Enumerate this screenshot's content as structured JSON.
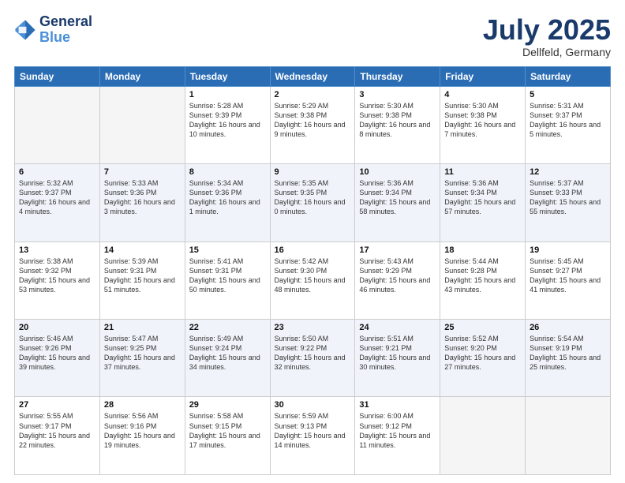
{
  "header": {
    "logo_line1": "General",
    "logo_line2": "Blue",
    "month": "July 2025",
    "location": "Dellfeld, Germany"
  },
  "days_of_week": [
    "Sunday",
    "Monday",
    "Tuesday",
    "Wednesday",
    "Thursday",
    "Friday",
    "Saturday"
  ],
  "weeks": [
    [
      {
        "day": "",
        "sunrise": "",
        "sunset": "",
        "daylight": ""
      },
      {
        "day": "",
        "sunrise": "",
        "sunset": "",
        "daylight": ""
      },
      {
        "day": "1",
        "sunrise": "Sunrise: 5:28 AM",
        "sunset": "Sunset: 9:39 PM",
        "daylight": "Daylight: 16 hours and 10 minutes."
      },
      {
        "day": "2",
        "sunrise": "Sunrise: 5:29 AM",
        "sunset": "Sunset: 9:38 PM",
        "daylight": "Daylight: 16 hours and 9 minutes."
      },
      {
        "day": "3",
        "sunrise": "Sunrise: 5:30 AM",
        "sunset": "Sunset: 9:38 PM",
        "daylight": "Daylight: 16 hours and 8 minutes."
      },
      {
        "day": "4",
        "sunrise": "Sunrise: 5:30 AM",
        "sunset": "Sunset: 9:38 PM",
        "daylight": "Daylight: 16 hours and 7 minutes."
      },
      {
        "day": "5",
        "sunrise": "Sunrise: 5:31 AM",
        "sunset": "Sunset: 9:37 PM",
        "daylight": "Daylight: 16 hours and 5 minutes."
      }
    ],
    [
      {
        "day": "6",
        "sunrise": "Sunrise: 5:32 AM",
        "sunset": "Sunset: 9:37 PM",
        "daylight": "Daylight: 16 hours and 4 minutes."
      },
      {
        "day": "7",
        "sunrise": "Sunrise: 5:33 AM",
        "sunset": "Sunset: 9:36 PM",
        "daylight": "Daylight: 16 hours and 3 minutes."
      },
      {
        "day": "8",
        "sunrise": "Sunrise: 5:34 AM",
        "sunset": "Sunset: 9:36 PM",
        "daylight": "Daylight: 16 hours and 1 minute."
      },
      {
        "day": "9",
        "sunrise": "Sunrise: 5:35 AM",
        "sunset": "Sunset: 9:35 PM",
        "daylight": "Daylight: 16 hours and 0 minutes."
      },
      {
        "day": "10",
        "sunrise": "Sunrise: 5:36 AM",
        "sunset": "Sunset: 9:34 PM",
        "daylight": "Daylight: 15 hours and 58 minutes."
      },
      {
        "day": "11",
        "sunrise": "Sunrise: 5:36 AM",
        "sunset": "Sunset: 9:34 PM",
        "daylight": "Daylight: 15 hours and 57 minutes."
      },
      {
        "day": "12",
        "sunrise": "Sunrise: 5:37 AM",
        "sunset": "Sunset: 9:33 PM",
        "daylight": "Daylight: 15 hours and 55 minutes."
      }
    ],
    [
      {
        "day": "13",
        "sunrise": "Sunrise: 5:38 AM",
        "sunset": "Sunset: 9:32 PM",
        "daylight": "Daylight: 15 hours and 53 minutes."
      },
      {
        "day": "14",
        "sunrise": "Sunrise: 5:39 AM",
        "sunset": "Sunset: 9:31 PM",
        "daylight": "Daylight: 15 hours and 51 minutes."
      },
      {
        "day": "15",
        "sunrise": "Sunrise: 5:41 AM",
        "sunset": "Sunset: 9:31 PM",
        "daylight": "Daylight: 15 hours and 50 minutes."
      },
      {
        "day": "16",
        "sunrise": "Sunrise: 5:42 AM",
        "sunset": "Sunset: 9:30 PM",
        "daylight": "Daylight: 15 hours and 48 minutes."
      },
      {
        "day": "17",
        "sunrise": "Sunrise: 5:43 AM",
        "sunset": "Sunset: 9:29 PM",
        "daylight": "Daylight: 15 hours and 46 minutes."
      },
      {
        "day": "18",
        "sunrise": "Sunrise: 5:44 AM",
        "sunset": "Sunset: 9:28 PM",
        "daylight": "Daylight: 15 hours and 43 minutes."
      },
      {
        "day": "19",
        "sunrise": "Sunrise: 5:45 AM",
        "sunset": "Sunset: 9:27 PM",
        "daylight": "Daylight: 15 hours and 41 minutes."
      }
    ],
    [
      {
        "day": "20",
        "sunrise": "Sunrise: 5:46 AM",
        "sunset": "Sunset: 9:26 PM",
        "daylight": "Daylight: 15 hours and 39 minutes."
      },
      {
        "day": "21",
        "sunrise": "Sunrise: 5:47 AM",
        "sunset": "Sunset: 9:25 PM",
        "daylight": "Daylight: 15 hours and 37 minutes."
      },
      {
        "day": "22",
        "sunrise": "Sunrise: 5:49 AM",
        "sunset": "Sunset: 9:24 PM",
        "daylight": "Daylight: 15 hours and 34 minutes."
      },
      {
        "day": "23",
        "sunrise": "Sunrise: 5:50 AM",
        "sunset": "Sunset: 9:22 PM",
        "daylight": "Daylight: 15 hours and 32 minutes."
      },
      {
        "day": "24",
        "sunrise": "Sunrise: 5:51 AM",
        "sunset": "Sunset: 9:21 PM",
        "daylight": "Daylight: 15 hours and 30 minutes."
      },
      {
        "day": "25",
        "sunrise": "Sunrise: 5:52 AM",
        "sunset": "Sunset: 9:20 PM",
        "daylight": "Daylight: 15 hours and 27 minutes."
      },
      {
        "day": "26",
        "sunrise": "Sunrise: 5:54 AM",
        "sunset": "Sunset: 9:19 PM",
        "daylight": "Daylight: 15 hours and 25 minutes."
      }
    ],
    [
      {
        "day": "27",
        "sunrise": "Sunrise: 5:55 AM",
        "sunset": "Sunset: 9:17 PM",
        "daylight": "Daylight: 15 hours and 22 minutes."
      },
      {
        "day": "28",
        "sunrise": "Sunrise: 5:56 AM",
        "sunset": "Sunset: 9:16 PM",
        "daylight": "Daylight: 15 hours and 19 minutes."
      },
      {
        "day": "29",
        "sunrise": "Sunrise: 5:58 AM",
        "sunset": "Sunset: 9:15 PM",
        "daylight": "Daylight: 15 hours and 17 minutes."
      },
      {
        "day": "30",
        "sunrise": "Sunrise: 5:59 AM",
        "sunset": "Sunset: 9:13 PM",
        "daylight": "Daylight: 15 hours and 14 minutes."
      },
      {
        "day": "31",
        "sunrise": "Sunrise: 6:00 AM",
        "sunset": "Sunset: 9:12 PM",
        "daylight": "Daylight: 15 hours and 11 minutes."
      },
      {
        "day": "",
        "sunrise": "",
        "sunset": "",
        "daylight": ""
      },
      {
        "day": "",
        "sunrise": "",
        "sunset": "",
        "daylight": ""
      }
    ]
  ]
}
